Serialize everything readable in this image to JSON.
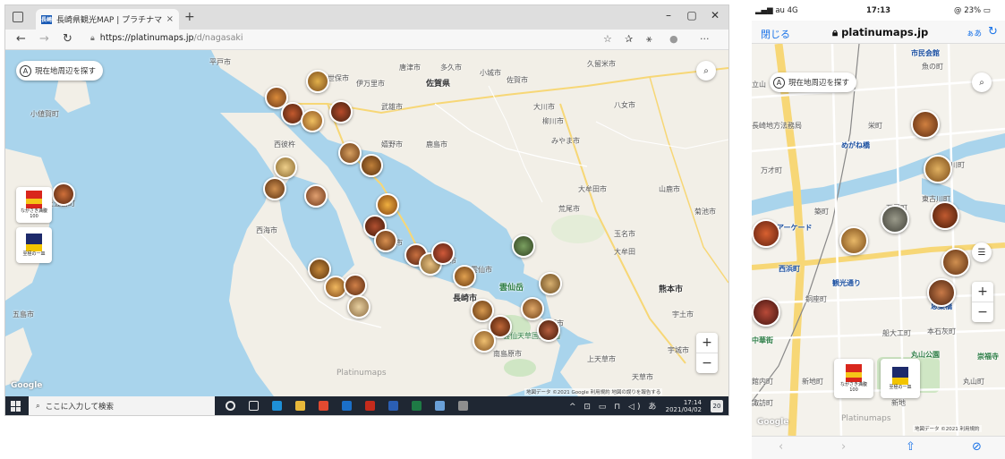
{
  "desktop": {
    "tab": {
      "favicon_text": "長崎",
      "title": "長崎県観光MAP | プラチナマップ",
      "close": "×"
    },
    "new_tab": "+",
    "window_controls": {
      "minimize": "–",
      "maximize": "▢",
      "close": "✕"
    },
    "nav": {
      "back": "←",
      "forward": "→",
      "refresh": "↻"
    },
    "url": {
      "host": "https://platinumaps.jp",
      "path": "/d/nagasaki"
    },
    "toolbar_icons": [
      "☆",
      "✰",
      "⚹",
      "●",
      "···"
    ],
    "map": {
      "locate_button": "現在地周辺を探す",
      "locate_letter": "A",
      "search_glyph": "⌕",
      "zoom_in": "+",
      "zoom_out": "−",
      "watermark": "Platinumaps",
      "google": "Google",
      "attribution": "地図データ ©2021 Google   利用規約   地図の誤りを報告する",
      "place_labels": [
        {
          "text": "平戸市"
        },
        {
          "text": "佐世保市"
        },
        {
          "text": "伊万里市"
        },
        {
          "text": "唐津市"
        },
        {
          "text": "多久市"
        },
        {
          "text": "小城市"
        },
        {
          "text": "佐賀県"
        },
        {
          "text": "佐賀市"
        },
        {
          "text": "大川市"
        },
        {
          "text": "柳川市"
        },
        {
          "text": "久留米市"
        },
        {
          "text": "八女市"
        },
        {
          "text": "みやま市"
        },
        {
          "text": "大牟田市"
        },
        {
          "text": "荒尾市"
        },
        {
          "text": "山鹿市"
        },
        {
          "text": "玉名市"
        },
        {
          "text": "菊池市"
        },
        {
          "text": "熊本市"
        },
        {
          "text": "宇土市"
        },
        {
          "text": "宇城市"
        },
        {
          "text": "天草市"
        },
        {
          "text": "上天草市"
        },
        {
          "text": "嬉野市"
        },
        {
          "text": "鹿島市"
        },
        {
          "text": "武雄市"
        },
        {
          "text": "大村市"
        },
        {
          "text": "諫早市"
        },
        {
          "text": "雲仙市"
        },
        {
          "text": "島原市"
        },
        {
          "text": "南島原市"
        },
        {
          "text": "西海市"
        },
        {
          "text": "長崎市"
        },
        {
          "text": "西彼杵"
        },
        {
          "text": "大牟田"
        },
        {
          "text": "五島市"
        },
        {
          "text": "小値賀町"
        },
        {
          "text": "新上五島町"
        },
        {
          "text": "雲仙岳"
        },
        {
          "text": "雲仙天草国立公園"
        }
      ],
      "cards": [
        {
          "caption": "ながさき満腹\n100"
        },
        {
          "caption": "至極の一皿"
        }
      ]
    },
    "taskbar": {
      "search_placeholder": "ここに入力して検索",
      "tray_icons": "^ ⊡ ▭ ⊓ ◁) あ",
      "time": "17:14",
      "date": "2021/04/02",
      "notify_count": "20"
    }
  },
  "phone": {
    "status": {
      "carrier": "au 4G",
      "time": "17:13",
      "battery": "@ 23%"
    },
    "close": "閉じる",
    "domain": "platinumaps.jp",
    "text_size": "ぁあ",
    "reload": "↻",
    "map": {
      "locate_button": "現在地周辺を探す",
      "locate_letter": "A",
      "search_glyph": "⌕",
      "list_glyph": "☰",
      "zoom_in": "+",
      "zoom_out": "−",
      "watermark": "Platinumaps",
      "google": "Google",
      "attribution": "地図データ ©2021   利用規約",
      "labels": [
        {
          "text": "市民会館"
        },
        {
          "text": "魚の町"
        },
        {
          "text": "立山"
        },
        {
          "text": "長崎地方法務局"
        },
        {
          "text": "栄町"
        },
        {
          "text": "めがね橋"
        },
        {
          "text": "万才町"
        },
        {
          "text": "川町"
        },
        {
          "text": "築町"
        },
        {
          "text": "万屋町"
        },
        {
          "text": "東古川町"
        },
        {
          "text": "浜町アーケード"
        },
        {
          "text": "西浜町"
        },
        {
          "text": "観光通り"
        },
        {
          "text": "銅座町"
        },
        {
          "text": "思案橋"
        },
        {
          "text": "船大工町"
        },
        {
          "text": "本石灰町"
        },
        {
          "text": "中華街"
        },
        {
          "text": "丸山公園"
        },
        {
          "text": "丸山町"
        },
        {
          "text": "崇福寺"
        },
        {
          "text": "館内町"
        },
        {
          "text": "新地町"
        },
        {
          "text": "諏訪町"
        },
        {
          "text": "新地"
        }
      ],
      "cards": [
        {
          "caption": "ながさき満腹\n100"
        },
        {
          "caption": "至極の一皿"
        }
      ]
    },
    "bottom": {
      "back": "‹",
      "forward": "›",
      "share": "⇧",
      "compass": "⊘"
    }
  },
  "colors": {
    "water": "#a9d4ec",
    "land": "#f2efe7",
    "park": "#cfe6c4",
    "road_main": "#f7d776",
    "road_minor": "#ffffff",
    "accent_blue": "#1a73e8",
    "taskbar": "#1f2733"
  }
}
